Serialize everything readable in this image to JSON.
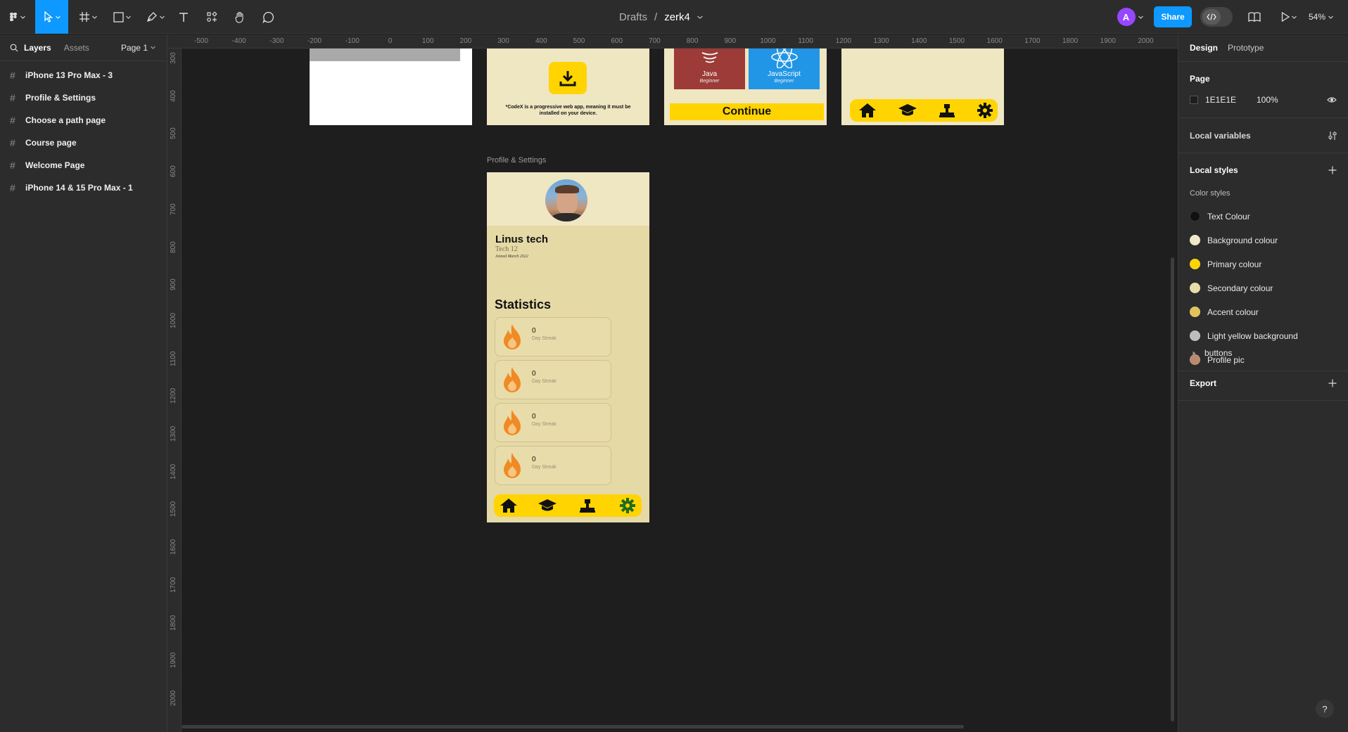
{
  "topbar": {
    "breadcrumb_parent": "Drafts",
    "breadcrumb_sep": "/",
    "file_name": "zerk4",
    "avatar_letter": "A",
    "share_label": "Share",
    "zoom": "54%"
  },
  "left_panel": {
    "tabs": [
      "Layers",
      "Assets"
    ],
    "page_selector": "Page 1",
    "layers": [
      "iPhone 13 Pro Max - 3",
      "Profile & Settings",
      "Choose a path page",
      "Course page",
      "Welcome Page",
      "iPhone 14 & 15 Pro Max - 1"
    ]
  },
  "rulers": {
    "top": [
      "-500",
      "-400",
      "-300",
      "-200",
      "-100",
      "0",
      "100",
      "200",
      "300",
      "400",
      "500",
      "600",
      "700",
      "800",
      "900",
      "1000",
      "1100",
      "1200",
      "1300",
      "1400",
      "1500",
      "1600",
      "1700",
      "1800",
      "1900",
      "2000",
      "2"
    ],
    "left": [
      "300",
      "400",
      "500",
      "600",
      "700",
      "800",
      "900",
      "1000",
      "1100",
      "1200",
      "1300",
      "1400",
      "1500",
      "1600",
      "1700",
      "1800",
      "1900",
      "2000"
    ]
  },
  "canvas": {
    "frame1": {},
    "frame2": {
      "note": "*CodeX is a progressive web app, meaning it must be installed on your device."
    },
    "frame3": {
      "course_left": "Java",
      "course_left_level": "Beginner",
      "course_right": "JavaScript",
      "course_right_level": "Beginner",
      "continue_label": "Continue"
    },
    "profile_frame": {
      "label": "Profile & Settings",
      "name": "Linus tech",
      "subtitle": "Tech 12",
      "joined": "Joined March 2022",
      "stats_title": "Statistics",
      "stats": [
        {
          "value": "0",
          "caption": "Day Streak"
        },
        {
          "value": "0",
          "caption": "Day Streak"
        },
        {
          "value": "0",
          "caption": "Day Streak"
        },
        {
          "value": "0",
          "caption": "Day Streak"
        }
      ]
    }
  },
  "right_panel": {
    "tabs": [
      "Design",
      "Prototype"
    ],
    "page_section_title": "Page",
    "page_color_hex": "1E1E1E",
    "page_opacity": "100%",
    "local_variables": "Local variables",
    "local_styles": "Local styles",
    "color_styles_title": "Color styles",
    "color_styles": [
      {
        "name": "Text Colour",
        "color": "#111111"
      },
      {
        "name": "Background colour",
        "color": "#f0e8c8"
      },
      {
        "name": "Primary colour",
        "color": "#ffd400"
      },
      {
        "name": "Secondary colour",
        "color": "#e8dca8"
      },
      {
        "name": "Accent colour",
        "color": "#e2c25a"
      },
      {
        "name": "Light yellow background",
        "color": "#bdbdbd"
      },
      {
        "name": "Profile pic",
        "color": "#b98a70"
      }
    ],
    "group_label": "buttons",
    "export_label": "Export"
  },
  "help_label": "?",
  "colors": {
    "app_bg": "#1e1e1e",
    "panel_bg": "#2c2c2c",
    "accent_blue": "#0d99ff",
    "frame_bg": "#ede4c0",
    "nav_yellow": "#ffd400"
  }
}
